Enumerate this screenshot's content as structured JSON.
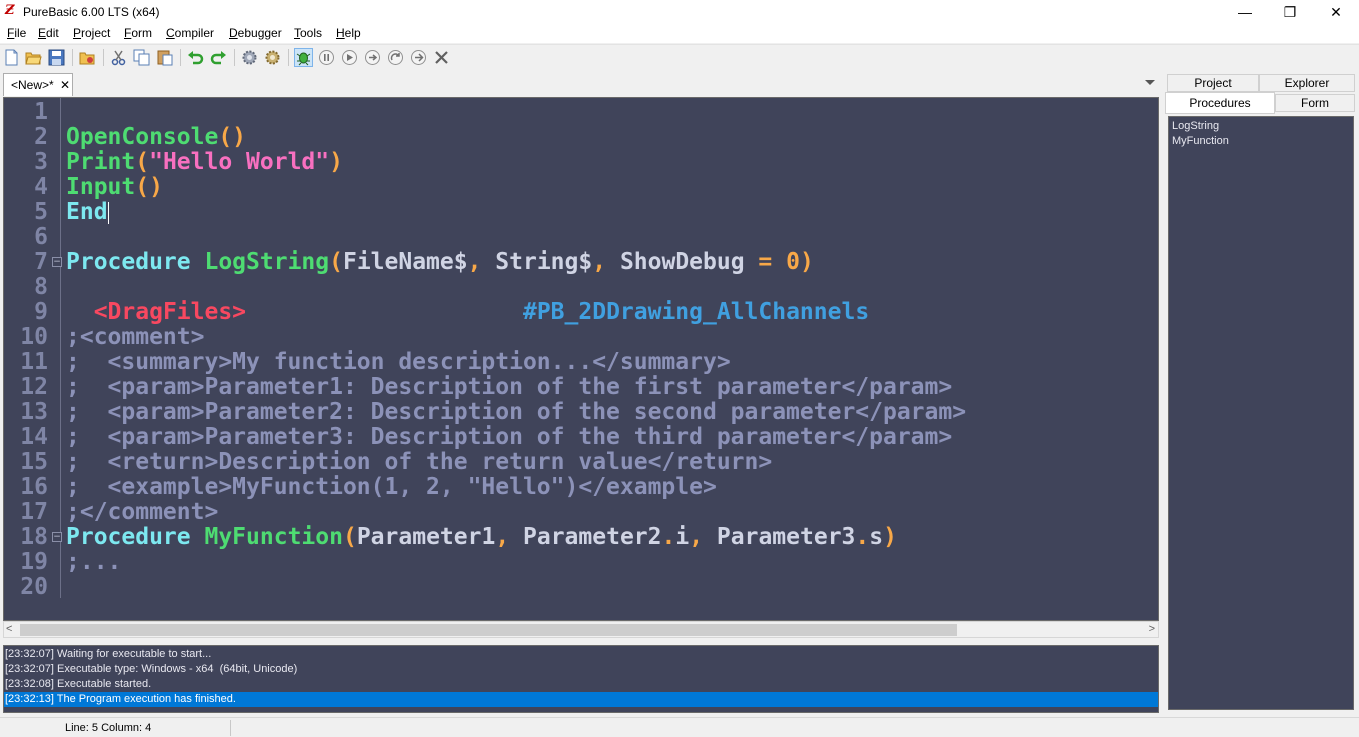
{
  "window": {
    "title": "PureBasic 6.00 LTS (x64)",
    "app_icon_glyph": "Ƶ",
    "minimize": "—",
    "maximize": "❐",
    "close": "✕"
  },
  "menu": [
    "File",
    "Edit",
    "Project",
    "Form",
    "Compiler",
    "Debugger",
    "Tools",
    "Help"
  ],
  "toolbar_icons": [
    "new-file-icon",
    "open-file-icon",
    "save-icon",
    "open-project-icon",
    "cut-icon",
    "copy-icon",
    "paste-icon",
    "undo-icon",
    "redo-icon",
    "compile-run-icon",
    "build-icon",
    "debugger-icon",
    "pause-icon",
    "step-icon",
    "step-over-icon",
    "step-out-icon",
    "stop-icon",
    "kill-icon"
  ],
  "editor_tab": {
    "label": "<New>*",
    "close": "✕"
  },
  "code": [
    {
      "n": "1",
      "parts": []
    },
    {
      "n": "2",
      "parts": [
        [
          "fn",
          "OpenConsole"
        ],
        [
          "punc",
          "()"
        ]
      ]
    },
    {
      "n": "3",
      "parts": [
        [
          "fn",
          "Print"
        ],
        [
          "punc",
          "("
        ],
        [
          "str",
          "\"Hello World\""
        ],
        [
          "punc",
          ")"
        ]
      ]
    },
    {
      "n": "4",
      "parts": [
        [
          "fn",
          "Input"
        ],
        [
          "punc",
          "()"
        ]
      ]
    },
    {
      "n": "5",
      "parts": [
        [
          "kw",
          "End"
        ]
      ]
    },
    {
      "n": "6",
      "parts": []
    },
    {
      "n": "7",
      "fold": "−",
      "parts": [
        [
          "kw",
          "Procedure "
        ],
        [
          "fn",
          "LogString"
        ],
        [
          "punc",
          "("
        ],
        [
          "id",
          "FileName$"
        ],
        [
          "punc",
          ", "
        ],
        [
          "id",
          "String$"
        ],
        [
          "punc",
          ", "
        ],
        [
          "id",
          "ShowDebug "
        ],
        [
          "punc",
          "= "
        ],
        [
          "num",
          "0"
        ],
        [
          "punc",
          ")"
        ]
      ]
    },
    {
      "n": "8",
      "parts": []
    },
    {
      "n": "9",
      "parts": [
        [
          "id",
          "  "
        ],
        [
          "tag",
          "<DragFiles>"
        ],
        [
          "id",
          "                    "
        ],
        [
          "const",
          "#PB_2DDrawing_AllChannels"
        ]
      ]
    },
    {
      "n": "10",
      "parts": [
        [
          "cm",
          ";<comment>"
        ]
      ]
    },
    {
      "n": "11",
      "parts": [
        [
          "cm",
          ";  <summary>My function description...</summary>"
        ]
      ]
    },
    {
      "n": "12",
      "parts": [
        [
          "cm",
          ";  <param>Parameter1: Description of the first parameter</param>"
        ]
      ]
    },
    {
      "n": "13",
      "parts": [
        [
          "cm",
          ";  <param>Parameter2: Description of the second parameter</param>"
        ]
      ]
    },
    {
      "n": "14",
      "parts": [
        [
          "cm",
          ";  <param>Parameter3: Description of the third parameter</param>"
        ]
      ]
    },
    {
      "n": "15",
      "parts": [
        [
          "cm",
          ";  <return>Description of the return value</return>"
        ]
      ]
    },
    {
      "n": "16",
      "parts": [
        [
          "cm",
          ";  <example>MyFunction(1, 2, \"Hello\")</example>"
        ]
      ]
    },
    {
      "n": "17",
      "parts": [
        [
          "cm",
          ";</comment>"
        ]
      ]
    },
    {
      "n": "18",
      "fold": "−",
      "parts": [
        [
          "kw",
          "Procedure "
        ],
        [
          "fn",
          "MyFunction"
        ],
        [
          "punc",
          "("
        ],
        [
          "id",
          "Parameter1"
        ],
        [
          "punc",
          ", "
        ],
        [
          "id",
          "Parameter2"
        ],
        [
          "punc",
          "."
        ],
        [
          "id",
          "i"
        ],
        [
          "punc",
          ", "
        ],
        [
          "id",
          "Parameter3"
        ],
        [
          "punc",
          "."
        ],
        [
          "id",
          "s"
        ],
        [
          "punc",
          ")"
        ]
      ]
    },
    {
      "n": "19",
      "parts": [
        [
          "cm",
          ";..."
        ]
      ]
    },
    {
      "n": "20",
      "parts": []
    }
  ],
  "console": [
    {
      "text": "[23:32:07] Waiting for executable to start...",
      "selected": false
    },
    {
      "text": "[23:32:07] Executable type: Windows - x64  (64bit, Unicode)",
      "selected": false
    },
    {
      "text": "[23:32:08] Executable started.",
      "selected": false
    },
    {
      "text": "[23:32:13] The Program execution has finished.",
      "selected": true
    }
  ],
  "status": {
    "line_col": "Line: 5   Column: 4"
  },
  "side_tabs": {
    "project": "Project",
    "explorer": "Explorer",
    "procedures": "Procedures",
    "form": "Form"
  },
  "procedures": [
    "LogString",
    "MyFunction"
  ],
  "scroll": {
    "left_arrow": "<",
    "right_arrow": ">"
  }
}
